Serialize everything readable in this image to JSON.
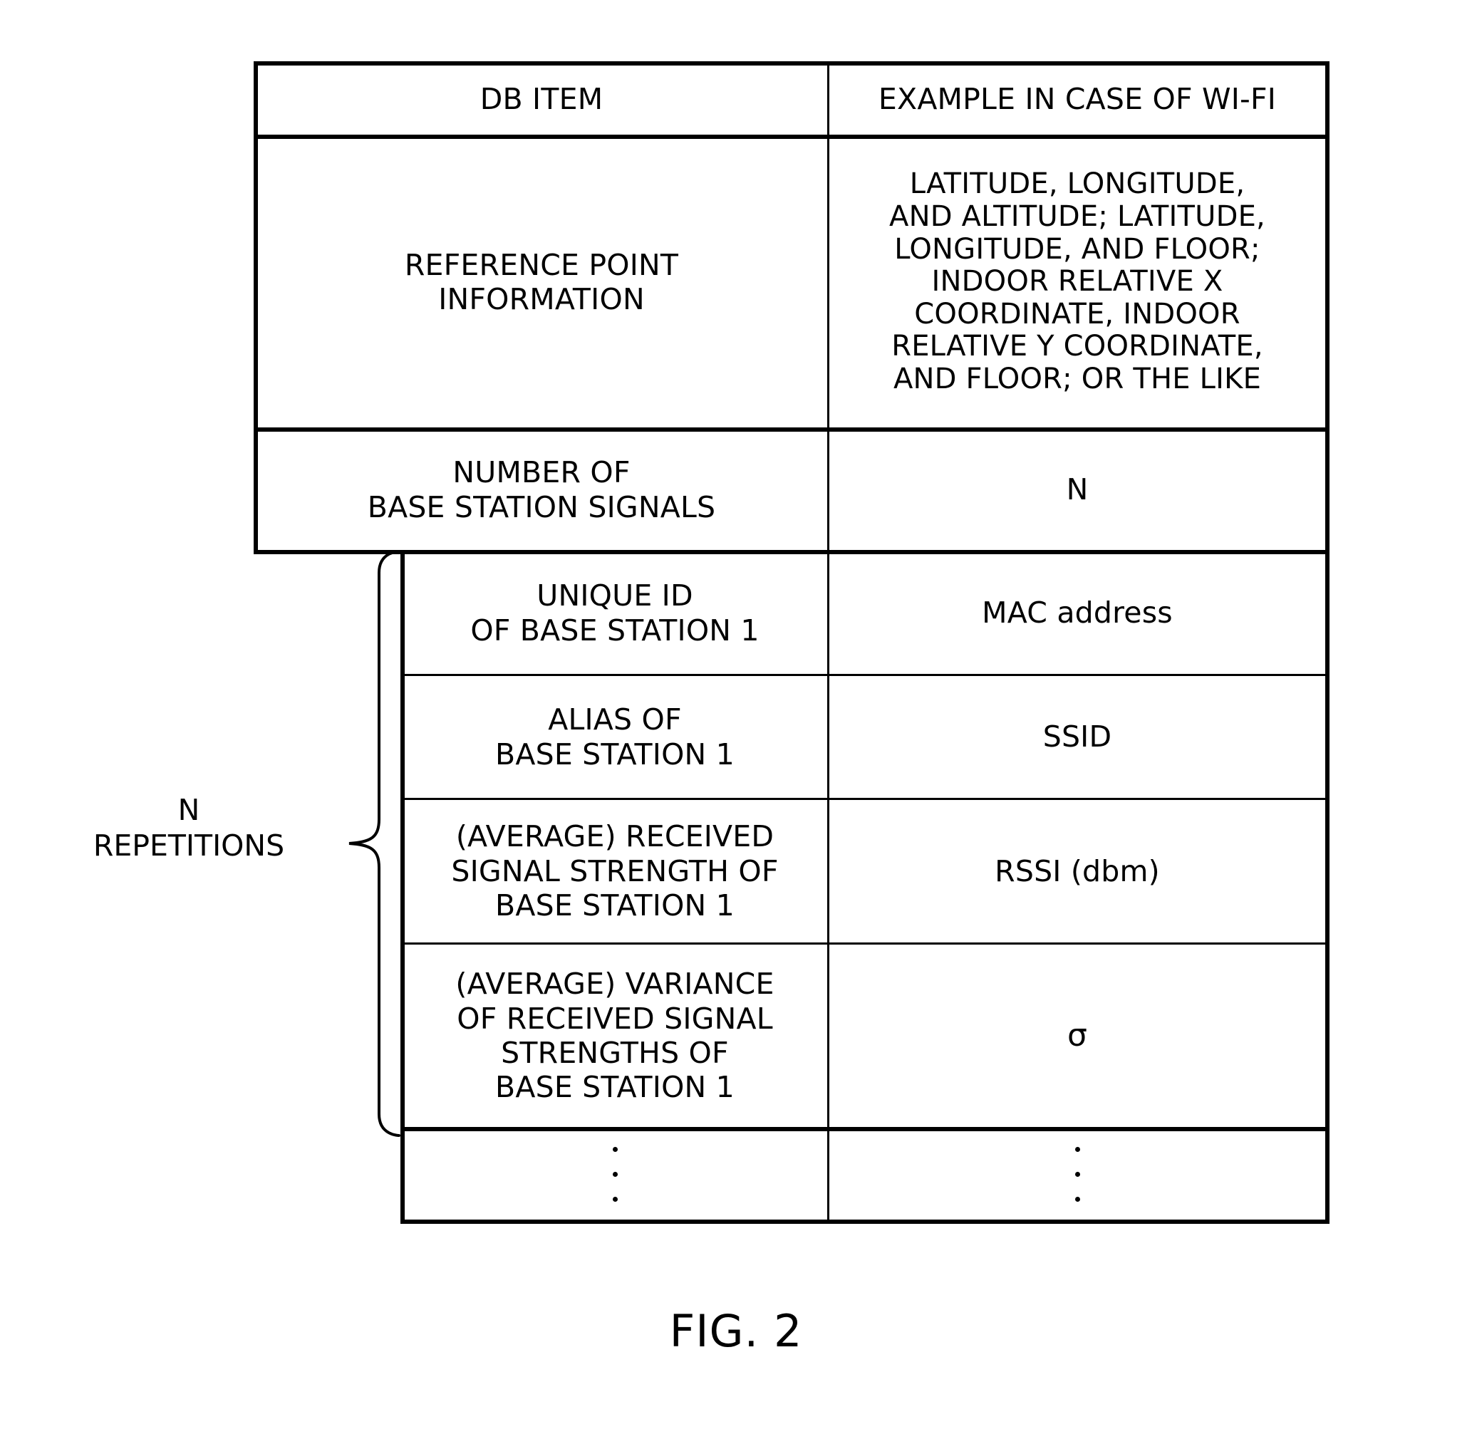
{
  "figure": {
    "caption": "FIG. 2",
    "repetitions_label_line1": "N",
    "repetitions_label_line2": "REPETITIONS"
  },
  "table": {
    "headers": {
      "col1": "DB ITEM",
      "col2": "EXAMPLE IN CASE OF WI-FI"
    },
    "rows": [
      {
        "item_lines": [
          "REFERENCE POINT",
          "INFORMATION"
        ],
        "example_lines": [
          "LATITUDE, LONGITUDE,",
          "AND ALTITUDE; LATITUDE,",
          "LONGITUDE, AND FLOOR;",
          "INDOOR RELATIVE X",
          "COORDINATE, INDOOR",
          "RELATIVE Y COORDINATE,",
          "AND FLOOR; OR THE LIKE"
        ]
      },
      {
        "item_lines": [
          "NUMBER OF",
          "BASE STATION SIGNALS"
        ],
        "example_lines": [
          "N"
        ]
      },
      {
        "item_lines": [
          "UNIQUE ID",
          "OF BASE STATION 1"
        ],
        "example_lines": [
          "MAC address"
        ]
      },
      {
        "item_lines": [
          "ALIAS OF",
          "BASE STATION 1"
        ],
        "example_lines": [
          "SSID"
        ]
      },
      {
        "item_lines": [
          "(AVERAGE) RECEIVED",
          "SIGNAL STRENGTH OF",
          "BASE STATION 1"
        ],
        "example_lines": [
          "RSSI (dbm)"
        ]
      },
      {
        "item_lines": [
          "(AVERAGE) VARIANCE",
          "OF RECEIVED SIGNAL",
          "STRENGTHS OF",
          "BASE STATION 1"
        ],
        "example_lines": [
          "σ"
        ]
      },
      {
        "item_lines": [
          "⋮"
        ],
        "example_lines": [
          "⋮"
        ]
      }
    ]
  },
  "colors": {
    "ink": "#000000",
    "paper": "#ffffff"
  }
}
